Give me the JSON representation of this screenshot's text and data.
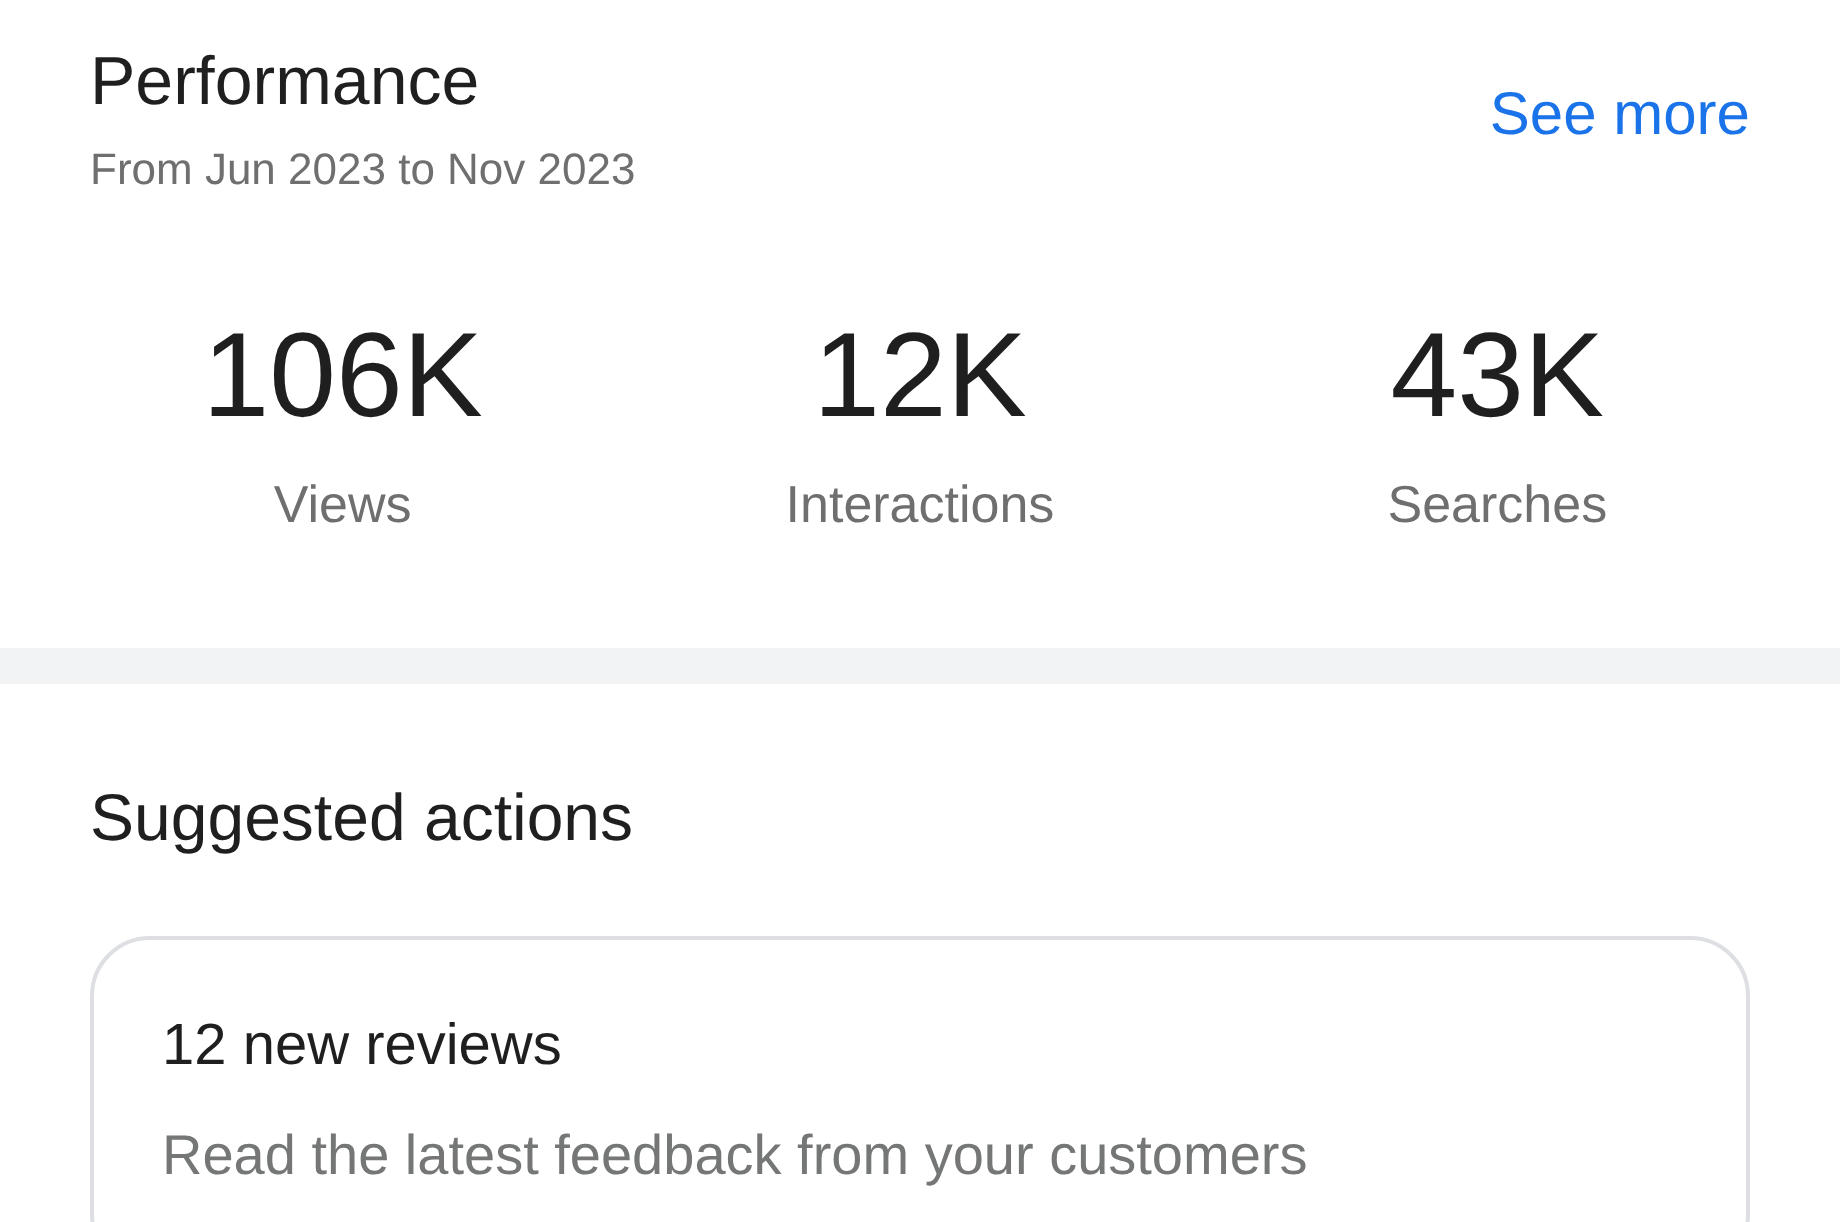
{
  "header": {
    "title": "Performance",
    "subtitle": "From Jun 2023 to Nov 2023",
    "link": "See more"
  },
  "stats": [
    {
      "value": "106K",
      "label": "Views"
    },
    {
      "value": "12K",
      "label": "Interactions"
    },
    {
      "value": "43K",
      "label": "Searches"
    }
  ],
  "suggested_actions": {
    "title": "Suggested actions",
    "cards": [
      {
        "title": "12 new reviews",
        "description": "Read the latest feedback from your customers"
      }
    ]
  }
}
